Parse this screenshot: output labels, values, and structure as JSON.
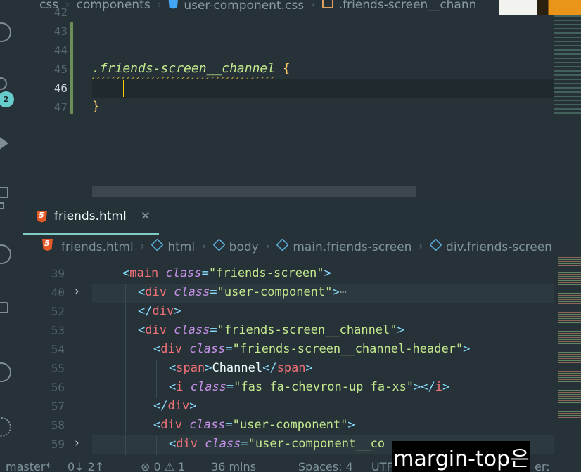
{
  "top_editor": {
    "breadcrumb": [
      "css",
      "components",
      "user-component.css",
      ".friends-screen__chann"
    ],
    "line_numbers": [
      "42",
      "43",
      "44",
      "45",
      "46",
      "47"
    ],
    "code": {
      "selector": ".friends-screen__channel",
      "open_brace": "{",
      "close_brace": "}"
    }
  },
  "activity_bar": {
    "scm_badge": "2"
  },
  "bottom_editor": {
    "tab": {
      "label": "friends.html",
      "close": "✕"
    },
    "breadcrumb": [
      "friends.html",
      "html",
      "body",
      "main.friends-screen",
      "div.friends-screen"
    ],
    "lines": [
      {
        "num": "39",
        "fold": "",
        "indent": 2,
        "parts": [
          [
            "p",
            "<"
          ],
          [
            "t",
            "main"
          ],
          [
            "a",
            " class"
          ],
          [
            "p",
            "="
          ],
          [
            "s",
            "\"friends-screen\""
          ],
          [
            "p",
            ">"
          ]
        ]
      },
      {
        "num": "40",
        "fold": "›",
        "indent": 3,
        "parts": [
          [
            "p",
            "<"
          ],
          [
            "t",
            "div"
          ],
          [
            "a",
            " class"
          ],
          [
            "p",
            "="
          ],
          [
            "s",
            "\"user-component\""
          ],
          [
            "p",
            ">"
          ],
          [
            "d",
            "⋯"
          ]
        ]
      },
      {
        "num": "52",
        "fold": "",
        "indent": 3,
        "parts": [
          [
            "p",
            "</"
          ],
          [
            "t",
            "div"
          ],
          [
            "p",
            ">"
          ]
        ]
      },
      {
        "num": "53",
        "fold": "",
        "indent": 3,
        "parts": [
          [
            "p",
            "<"
          ],
          [
            "t",
            "div"
          ],
          [
            "a",
            " class"
          ],
          [
            "p",
            "="
          ],
          [
            "s",
            "\"friends-screen__channel\""
          ],
          [
            "p",
            ">"
          ]
        ]
      },
      {
        "num": "54",
        "fold": "",
        "indent": 4,
        "parts": [
          [
            "p",
            "<"
          ],
          [
            "t",
            "div"
          ],
          [
            "a",
            " class"
          ],
          [
            "p",
            "="
          ],
          [
            "s",
            "\"friends-screen__channel-header\""
          ],
          [
            "p",
            ">"
          ]
        ]
      },
      {
        "num": "55",
        "fold": "",
        "indent": 5,
        "parts": [
          [
            "p",
            "<"
          ],
          [
            "t",
            "span"
          ],
          [
            "p",
            ">"
          ],
          [
            "x",
            "Channel"
          ],
          [
            "p",
            "</"
          ],
          [
            "t",
            "span"
          ],
          [
            "p",
            ">"
          ]
        ]
      },
      {
        "num": "56",
        "fold": "",
        "indent": 5,
        "parts": [
          [
            "p",
            "<"
          ],
          [
            "t",
            "i"
          ],
          [
            "a",
            " class"
          ],
          [
            "p",
            "="
          ],
          [
            "s",
            "\"fas fa-chevron-up fa-xs\""
          ],
          [
            "p",
            "></"
          ],
          [
            "t",
            "i"
          ],
          [
            "p",
            ">"
          ]
        ]
      },
      {
        "num": "57",
        "fold": "",
        "indent": 4,
        "parts": [
          [
            "p",
            "</"
          ],
          [
            "t",
            "div"
          ],
          [
            "p",
            ">"
          ]
        ]
      },
      {
        "num": "58",
        "fold": "",
        "indent": 4,
        "parts": [
          [
            "p",
            "<"
          ],
          [
            "t",
            "div"
          ],
          [
            "a",
            " class"
          ],
          [
            "p",
            "="
          ],
          [
            "s",
            "\"user-component\""
          ],
          [
            "p",
            ">"
          ]
        ]
      },
      {
        "num": "59",
        "fold": "›",
        "indent": 5,
        "parts": [
          [
            "p",
            "<"
          ],
          [
            "t",
            "div"
          ],
          [
            "a",
            " class"
          ],
          [
            "p",
            "="
          ],
          [
            "s",
            "\"user-component__co"
          ]
        ]
      }
    ]
  },
  "status_bar": {
    "branch": "master*",
    "sync": "0↓ 2↑",
    "problems": "⊗ 0 ⚠ 1",
    "time": "36 mins",
    "spaces": "Spaces: 4",
    "encoding": "UTF",
    "formatter": "er:"
  },
  "subtitle": "margin-top은",
  "colors": {
    "accent": "#80cbc4",
    "background": "#263238",
    "string": "#c3e88d",
    "tag": "#f07178",
    "attribute": "#c792ea"
  }
}
